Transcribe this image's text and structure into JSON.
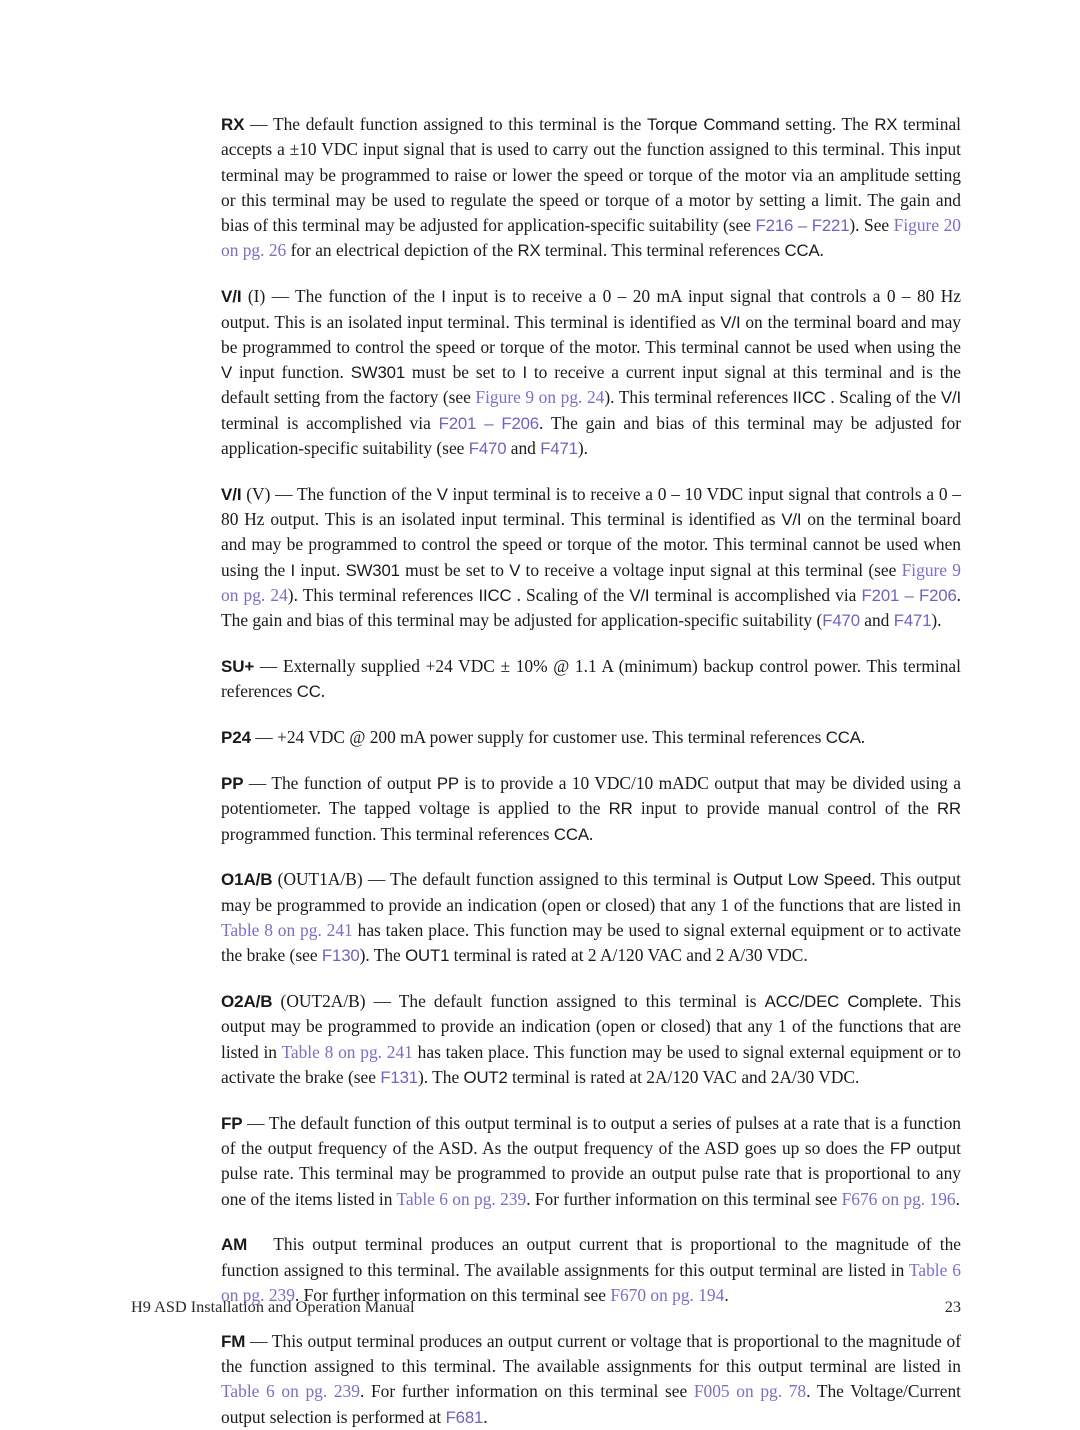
{
  "document": {
    "footer_title": "H9 ASD Installation and Operation Manual",
    "page_number": "23"
  },
  "colors": {
    "link_param": "#7262bd",
    "link_xref": "#7b6ec4",
    "body_text": "#1a1a1a",
    "page_background": "#ffffff"
  },
  "paragraphs": [
    {
      "id": "rx",
      "term": "RX",
      "dash": " — ",
      "runs": [
        {
          "style": "body",
          "text": "The default function assigned to this terminal is the "
        },
        {
          "style": "sans",
          "text": "Torque Command"
        },
        {
          "style": "body",
          "text": " setting. The "
        },
        {
          "style": "sans",
          "text": "RX"
        },
        {
          "style": "body",
          "text": " terminal accepts a ±10 VDC input signal that is used to carry out the function assigned to this terminal. This input terminal may be programmed to raise or lower the speed or torque of the motor via an amplitude setting or this terminal may be used to regulate the speed or torque of a motor by setting a limit. The gain and bias of this terminal may be adjusted for application-specific suitability (see "
        },
        {
          "style": "param",
          "text": "F216 – F221"
        },
        {
          "style": "body",
          "text": "). See "
        },
        {
          "style": "xref",
          "text": "Figure 20 on pg. 26"
        },
        {
          "style": "body",
          "text": " for an electrical depiction of the "
        },
        {
          "style": "sans",
          "text": "RX"
        },
        {
          "style": "body",
          "text": " terminal. This terminal references "
        },
        {
          "style": "sans",
          "text": "CCA"
        },
        {
          "style": "body",
          "text": "."
        }
      ]
    },
    {
      "id": "vi-current",
      "term": "V/I",
      "dash": " (I) — ",
      "runs": [
        {
          "style": "body",
          "text": "The function of the "
        },
        {
          "style": "sans",
          "text": "I"
        },
        {
          "style": "body",
          "text": " input is to receive a 0 – 20 mA input signal that controls a 0 – 80 Hz output. This is an isolated input terminal. This terminal is identified as "
        },
        {
          "style": "sans",
          "text": "V/I"
        },
        {
          "style": "body",
          "text": " on the terminal board and may be programmed to control the speed or torque of the motor. This terminal cannot be used when using the "
        },
        {
          "style": "sans",
          "text": "V"
        },
        {
          "style": "body",
          "text": " input function. "
        },
        {
          "style": "sans",
          "text": "SW301"
        },
        {
          "style": "body",
          "text": " must be set to "
        },
        {
          "style": "sans",
          "text": "I"
        },
        {
          "style": "body",
          "text": " to receive a current input signal at this terminal and is the default setting from the factory (see "
        },
        {
          "style": "xref",
          "text": "Figure 9 on pg. 24"
        },
        {
          "style": "body",
          "text": "). This terminal references "
        },
        {
          "style": "sans",
          "text": "IICC"
        },
        {
          "style": "body",
          "text": " . Scaling of the "
        },
        {
          "style": "sans",
          "text": "V/I"
        },
        {
          "style": "body",
          "text": " terminal is accomplished via "
        },
        {
          "style": "param",
          "text": "F201 – F206"
        },
        {
          "style": "body",
          "text": ". The gain and bias of this terminal may be adjusted for application-specific suitability (see "
        },
        {
          "style": "param",
          "text": "F470"
        },
        {
          "style": "body",
          "text": " and "
        },
        {
          "style": "param",
          "text": "F471"
        },
        {
          "style": "body",
          "text": ")."
        }
      ]
    },
    {
      "id": "vi-voltage",
      "term": "V/I",
      "dash": " (V) — ",
      "runs": [
        {
          "style": "body",
          "text": "The function of the "
        },
        {
          "style": "sans",
          "text": "V"
        },
        {
          "style": "body",
          "text": " input terminal is to receive a 0 – 10 VDC input signal that controls a 0 – 80 Hz output. This is an isolated input terminal. This terminal is identified as "
        },
        {
          "style": "sans",
          "text": "V/I"
        },
        {
          "style": "body",
          "text": " on the terminal board and may be programmed to control the speed or torque of the motor. This terminal cannot be used when using the "
        },
        {
          "style": "sans",
          "text": "I"
        },
        {
          "style": "body",
          "text": " input. "
        },
        {
          "style": "sans",
          "text": "SW301"
        },
        {
          "style": "body",
          "text": " must be set to "
        },
        {
          "style": "sans",
          "text": "V"
        },
        {
          "style": "body",
          "text": " to receive a voltage input signal at this terminal (see "
        },
        {
          "style": "xref",
          "text": "Figure 9 on pg. 24"
        },
        {
          "style": "body",
          "text": "). This terminal references "
        },
        {
          "style": "sans",
          "text": "IICC"
        },
        {
          "style": "body",
          "text": " . Scaling of the "
        },
        {
          "style": "sans",
          "text": "V/I"
        },
        {
          "style": "body",
          "text": " terminal is accomplished via "
        },
        {
          "style": "param",
          "text": "F201 – F206"
        },
        {
          "style": "body",
          "text": ". The gain and bias of this terminal may be adjusted for application-specific suitability ("
        },
        {
          "style": "param",
          "text": "F470"
        },
        {
          "style": "body",
          "text": " and "
        },
        {
          "style": "param",
          "text": "F471"
        },
        {
          "style": "body",
          "text": ")."
        }
      ]
    },
    {
      "id": "su-plus",
      "term": "SU+",
      "dash": " — ",
      "runs": [
        {
          "style": "body",
          "text": "Externally supplied +24 VDC ± 10% @ 1.1 A (minimum) backup control power. This terminal references "
        },
        {
          "style": "sans",
          "text": "CC"
        },
        {
          "style": "body",
          "text": "."
        }
      ]
    },
    {
      "id": "p24",
      "term": "P24",
      "dash": " — ",
      "runs": [
        {
          "style": "body",
          "text": "+24 VDC @ 200 mA power supply for customer use. This terminal references "
        },
        {
          "style": "sans",
          "text": "CCA"
        },
        {
          "style": "body",
          "text": "."
        }
      ]
    },
    {
      "id": "pp",
      "term": "PP",
      "dash": " — ",
      "runs": [
        {
          "style": "body",
          "text": "The function of output "
        },
        {
          "style": "sans",
          "text": "PP"
        },
        {
          "style": "body",
          "text": " is to provide a 10 VDC/10 mADC output that may be divided using a potentiometer. The tapped voltage is applied to the "
        },
        {
          "style": "sans",
          "text": "RR"
        },
        {
          "style": "body",
          "text": " input to provide manual control of the "
        },
        {
          "style": "sans",
          "text": "RR"
        },
        {
          "style": "body",
          "text": " programmed function. This terminal references "
        },
        {
          "style": "sans",
          "text": "CCA"
        },
        {
          "style": "body",
          "text": "."
        }
      ]
    },
    {
      "id": "o1ab",
      "term": "O1A/B",
      "dash": " (OUT1A/B) — ",
      "runs": [
        {
          "style": "body",
          "text": "The default function assigned to this terminal is "
        },
        {
          "style": "sans",
          "text": "Output Low Speed"
        },
        {
          "style": "body",
          "text": ". This output may be programmed to provide an indication (open or closed) that any 1 of the functions that are listed in "
        },
        {
          "style": "xref",
          "text": "Table 8 on pg. 241"
        },
        {
          "style": "body",
          "text": " has taken place. This function may be used to signal external equipment or to activate the brake (see "
        },
        {
          "style": "param",
          "text": "F130"
        },
        {
          "style": "body",
          "text": "). The "
        },
        {
          "style": "sans",
          "text": "OUT1"
        },
        {
          "style": "body",
          "text": " terminal is rated at 2 A/120 VAC and 2 A/30 VDC."
        }
      ]
    },
    {
      "id": "o2ab",
      "term": "O2A/B",
      "dash": " (OUT2A/B) — ",
      "runs": [
        {
          "style": "body",
          "text": "The default function assigned to this terminal is "
        },
        {
          "style": "sans",
          "text": "ACC/DEC Complete"
        },
        {
          "style": "body",
          "text": ". This output may be programmed to provide an indication (open or closed) that any 1 of the functions that are listed in "
        },
        {
          "style": "xref",
          "text": "Table 8 on pg. 241"
        },
        {
          "style": "body",
          "text": " has taken place. This function may be used to signal external equipment or to activate the brake (see "
        },
        {
          "style": "param",
          "text": "F131"
        },
        {
          "style": "body",
          "text": "). The "
        },
        {
          "style": "sans",
          "text": "OUT2"
        },
        {
          "style": "body",
          "text": " terminal is rated at 2A/120 VAC and 2A/30 VDC."
        }
      ]
    },
    {
      "id": "fp",
      "term": "FP",
      "dash": " — ",
      "runs": [
        {
          "style": "body",
          "text": "The default function of this output terminal is to output a series of pulses at a rate that is a function of the output frequency of the ASD. As the output frequency of the ASD goes up so does the "
        },
        {
          "style": "sans",
          "text": "FP"
        },
        {
          "style": "body",
          "text": " output pulse rate. This terminal may be programmed to provide an output pulse rate that is proportional to any one of the items listed in "
        },
        {
          "style": "xref",
          "text": "Table 6 on pg. 239"
        },
        {
          "style": "body",
          "text": ". For further information on this terminal see "
        },
        {
          "style": "xref",
          "text": "F676 on pg. 196"
        },
        {
          "style": "body",
          "text": "."
        }
      ]
    },
    {
      "id": "am",
      "term": "AM",
      "dash": "GAP",
      "runs": [
        {
          "style": "body",
          "text": "This output terminal produces an output current that is proportional to the magnitude of the function assigned to this terminal. The available assignments for this output terminal are listed in "
        },
        {
          "style": "xref",
          "text": "Table 6 on pg. 239"
        },
        {
          "style": "body",
          "text": ". For further information on this terminal see "
        },
        {
          "style": "xref",
          "text": "F670 on pg. 194"
        },
        {
          "style": "body",
          "text": "."
        }
      ]
    },
    {
      "id": "fm",
      "term": "FM",
      "dash": " — ",
      "runs": [
        {
          "style": "body",
          "text": "This output terminal produces an output current or voltage that is proportional to the magnitude of the function assigned to this terminal. The available assignments for this output terminal are listed in "
        },
        {
          "style": "xref",
          "text": "Table 6 on pg. 239"
        },
        {
          "style": "body",
          "text": ". For further information on this terminal see "
        },
        {
          "style": "xref",
          "text": "F005 on pg. 78"
        },
        {
          "style": "body",
          "text": ". The Voltage/Current output selection is performed at "
        },
        {
          "style": "param",
          "text": "F681"
        },
        {
          "style": "body",
          "text": "."
        }
      ]
    }
  ]
}
